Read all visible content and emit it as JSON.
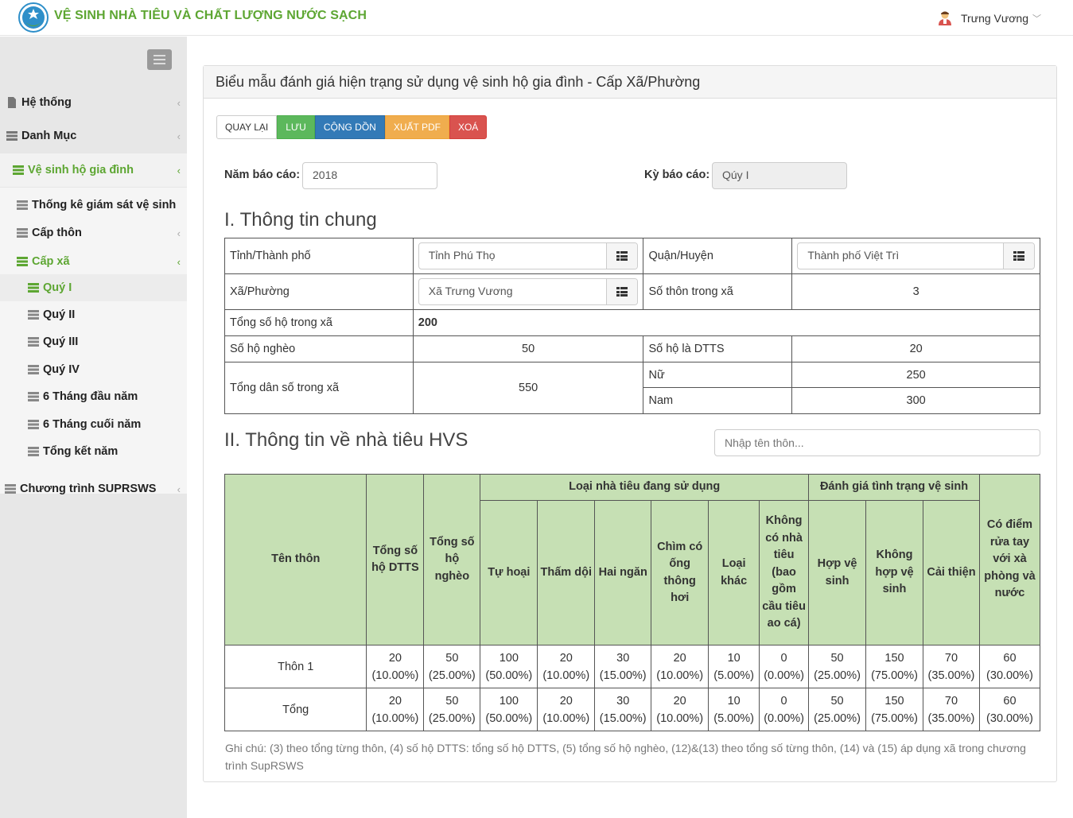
{
  "app": {
    "title": "VỆ SINH NHÀ TIÊU VÀ CHẤT LƯỢNG NƯỚC SẠCH",
    "user": "Trưng Vương"
  },
  "sidebar": {
    "items": [
      {
        "label": "Hệ thống"
      },
      {
        "label": "Danh Mục"
      },
      {
        "label": "Vệ sinh hộ gia đình"
      },
      {
        "label": "Thống kê giám sát vệ sinh"
      },
      {
        "label": "Cấp thôn"
      },
      {
        "label": "Cấp xã"
      },
      {
        "label": "Quý I"
      },
      {
        "label": "Quý II"
      },
      {
        "label": "Quý III"
      },
      {
        "label": "Quý IV"
      },
      {
        "label": "6 Tháng đầu năm"
      },
      {
        "label": "6 Tháng cuối năm"
      },
      {
        "label": "Tổng kết năm"
      },
      {
        "label": "Chương trình SUPRSWS"
      }
    ]
  },
  "panel": {
    "title": "Biểu mẫu đánh giá hiện trạng sử dụng vệ sinh hộ gia đình - Cấp Xã/Phường",
    "buttons": {
      "back": "QUAY LẠI",
      "save": "LƯU",
      "sum": "CỘNG DỒN",
      "pdf": "XUẤT PDF",
      "delete": "XOÁ"
    },
    "year_label": "Năm báo cáo:",
    "year_value": "2018",
    "period_label": "Kỳ báo cáo:",
    "period_value": "Qúy I"
  },
  "section1": {
    "title": "I. Thông tin chung",
    "province_label": "Tỉnh/Thành phố",
    "province_value": "Tỉnh Phú Thọ",
    "district_label": "Quận/Huyện",
    "district_value": "Thành phố Việt Trì",
    "commune_label": "Xã/Phường",
    "commune_value": "Xã Trưng Vương",
    "villages_label": "Số thôn trong xã",
    "villages_value": "3",
    "households_label": "Tổng số hộ trong xã",
    "households_value": "200",
    "poor_label": "Số hộ nghèo",
    "poor_value": "50",
    "ethnic_label": "Số hộ là DTTS",
    "ethnic_value": "20",
    "population_label": "Tổng dân số trong xã",
    "population_value": "550",
    "female_label": "Nữ",
    "female_value": "250",
    "male_label": "Nam",
    "male_value": "300"
  },
  "section2": {
    "title": "II. Thông tin về nhà tiêu HVS",
    "search_placeholder": "Nhập tên thôn...",
    "headers": {
      "village": "Tên thôn",
      "dtts": "Tổng số hộ DTTS",
      "poor": "Tổng số hộ nghèo",
      "type_group": "Loại nhà tiêu đang sử dụng",
      "septic": "Tự hoại",
      "seepage": "Thấm dội",
      "double": "Hai ngăn",
      "vent": "Chìm có ống thông hơi",
      "other": "Loại khác",
      "none": "Không có nhà tiêu (bao gồm cầu tiêu ao cá)",
      "eval_group": "Đánh giá tình trạng vệ sinh",
      "hygienic": "Hợp vệ sinh",
      "unhygienic": "Không hợp vệ sinh",
      "improved": "Cải thiện",
      "handwash": "Có điểm rửa tay với xà phòng và nước"
    },
    "rows": [
      {
        "name": "Thôn 1",
        "cells": [
          {
            "n": "20",
            "p": "(10.00%)"
          },
          {
            "n": "50",
            "p": "(25.00%)"
          },
          {
            "n": "100",
            "p": "(50.00%)"
          },
          {
            "n": "20",
            "p": "(10.00%)"
          },
          {
            "n": "30",
            "p": "(15.00%)"
          },
          {
            "n": "20",
            "p": "(10.00%)"
          },
          {
            "n": "10",
            "p": "(5.00%)"
          },
          {
            "n": "0",
            "p": "(0.00%)"
          },
          {
            "n": "50",
            "p": "(25.00%)"
          },
          {
            "n": "150",
            "p": "(75.00%)"
          },
          {
            "n": "70",
            "p": "(35.00%)"
          },
          {
            "n": "60",
            "p": "(30.00%)"
          }
        ]
      },
      {
        "name": "Tổng",
        "cells": [
          {
            "n": "20",
            "p": "(10.00%)"
          },
          {
            "n": "50",
            "p": "(25.00%)"
          },
          {
            "n": "100",
            "p": "(50.00%)"
          },
          {
            "n": "20",
            "p": "(10.00%)"
          },
          {
            "n": "30",
            "p": "(15.00%)"
          },
          {
            "n": "20",
            "p": "(10.00%)"
          },
          {
            "n": "10",
            "p": "(5.00%)"
          },
          {
            "n": "0",
            "p": "(0.00%)"
          },
          {
            "n": "50",
            "p": "(25.00%)"
          },
          {
            "n": "150",
            "p": "(75.00%)"
          },
          {
            "n": "70",
            "p": "(35.00%)"
          },
          {
            "n": "60",
            "p": "(30.00%)"
          }
        ]
      }
    ],
    "note": "Ghi chú: (3) theo tổng từng thôn, (4) số hộ DTTS: tổng số hộ DTTS, (5) tổng số hộ nghèo, (12)&(13) theo tổng số từng thôn, (14) và (15) áp dụng xã trong chương trình SupRSWS"
  },
  "colors": {
    "brand": "#5da632",
    "header_green": "#c6e0b4"
  }
}
